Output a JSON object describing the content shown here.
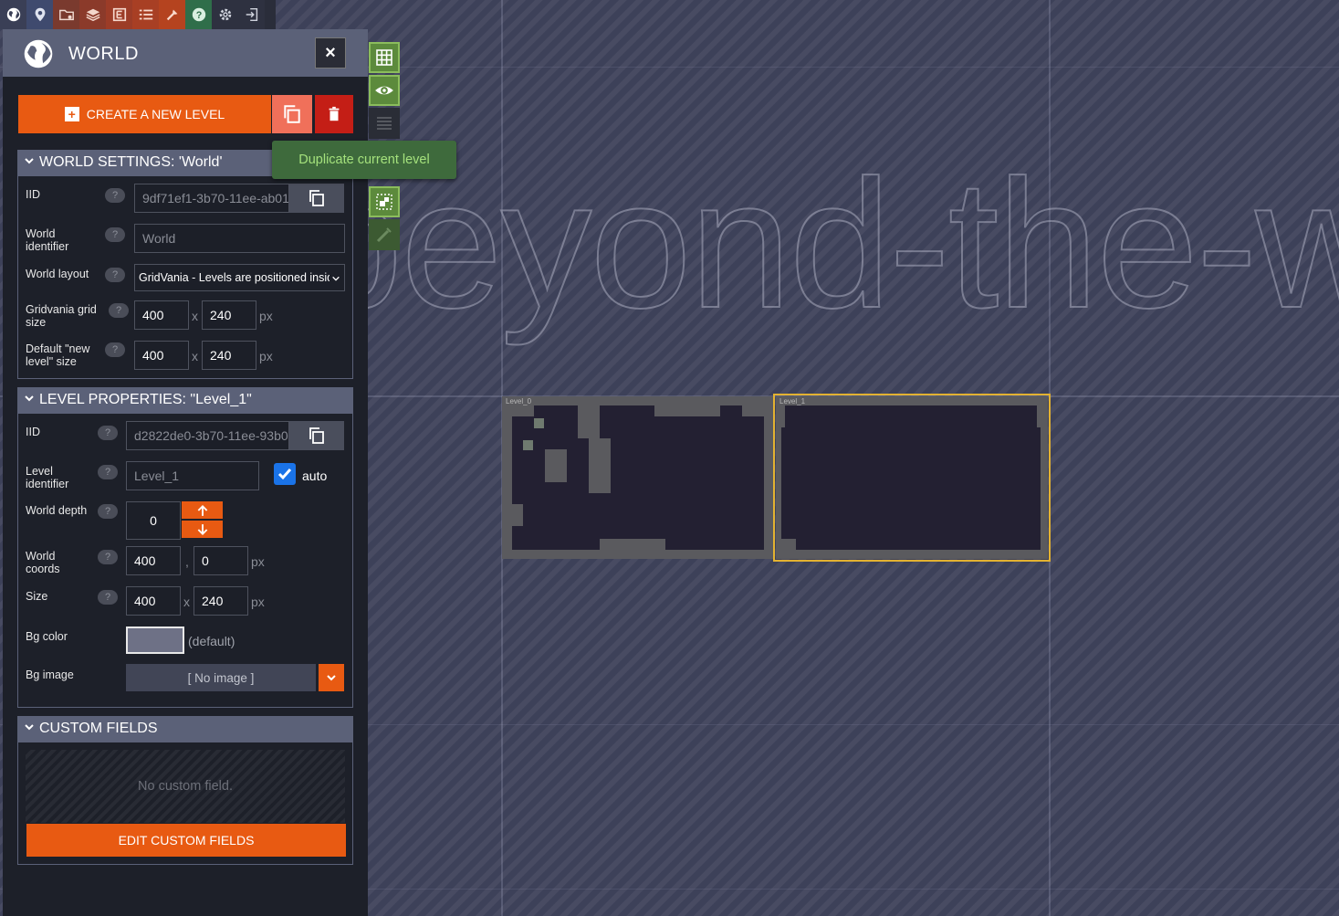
{
  "colors": {
    "accent_orange": "#e85a12",
    "panel_bg": "#1d2029",
    "section_header": "#5b6178",
    "canvas_bg": "#3d4159",
    "selection_yellow": "#e3b231",
    "tooltip_bg": "#3e6a3c",
    "tooltip_text": "#a4e17c",
    "delete_red": "#c41e16",
    "duplicate_pink": "#f0705a",
    "checkbox_blue": "#1a73e8"
  },
  "toolbar": {
    "icons": [
      "world-icon",
      "pin-icon",
      "folder-gear-icon",
      "layers-icon",
      "entity-icon",
      "list-icon",
      "tools-icon",
      "help-icon",
      "gear-icon",
      "exit-icon"
    ]
  },
  "panel": {
    "title": "WORLD",
    "close_label": "×",
    "create_level_label": "CREATE A NEW LEVEL",
    "tooltip": "Duplicate current level"
  },
  "world_settings": {
    "header": "WORLD SETTINGS: 'World'",
    "iid_label": "IID",
    "iid_value": "9df71ef1-3b70-11ee-ab01",
    "identifier_label": "World identifier",
    "identifier_value": "World",
    "layout_label": "World layout",
    "layout_value": "GridVania - Levels are positioned inside",
    "grid_size_label": "Gridvania grid size",
    "grid_w": "400",
    "grid_h": "240",
    "default_size_label": "Default \"new level\" size",
    "default_w": "400",
    "default_h": "240",
    "x_sep": "x",
    "unit": "px",
    "help": "?"
  },
  "level_properties": {
    "header": "LEVEL PROPERTIES: \"Level_1\"",
    "iid_label": "IID",
    "iid_value": "d2822de0-3b70-11ee-93b0",
    "identifier_label": "Level identifier",
    "identifier_value": "Level_1",
    "auto_label": "auto",
    "auto_checked": true,
    "depth_label": "World depth",
    "depth_value": "0",
    "coords_label": "World coords",
    "coord_x": "400",
    "coord_y": "0",
    "comma_sep": ",",
    "size_label": "Size",
    "size_w": "400",
    "size_h": "240",
    "bg_color_label": "Bg color",
    "bg_color_value": "(default)",
    "bg_color_swatch": "#6e7186",
    "bg_image_label": "Bg image",
    "bg_image_value": "[ No image ]"
  },
  "custom_fields": {
    "header": "CUSTOM FIELDS",
    "empty_text": "No custom field.",
    "edit_label": "EDIT CUSTOM FIELDS"
  },
  "canvas": {
    "world_name_text": "beyond-the-wall",
    "levels": [
      {
        "name": "Level_0",
        "selected": false
      },
      {
        "name": "Level_1",
        "selected": true
      }
    ]
  },
  "side_tools": {
    "icons": [
      "grid-toggle-icon",
      "eye-icon",
      "list-disabled-icon",
      "layout-icon",
      "pencil-disabled-icon"
    ]
  }
}
